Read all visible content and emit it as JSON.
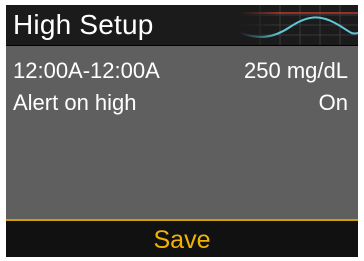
{
  "header": {
    "title": "High Setup"
  },
  "settings": [
    {
      "left": "12:00A-12:00A",
      "right": "250 mg/dL"
    },
    {
      "left": "Alert on high",
      "right": "On"
    }
  ],
  "footer": {
    "save_label": "Save"
  },
  "colors": {
    "screen_bg": "#5f5f5f",
    "header_bg": "#1b1b1b",
    "text": "#ffffff",
    "save_text": "#f0b400",
    "save_border": "#d0a000"
  },
  "icons": {
    "header_graphic": "glucose-trend-graph-icon"
  }
}
